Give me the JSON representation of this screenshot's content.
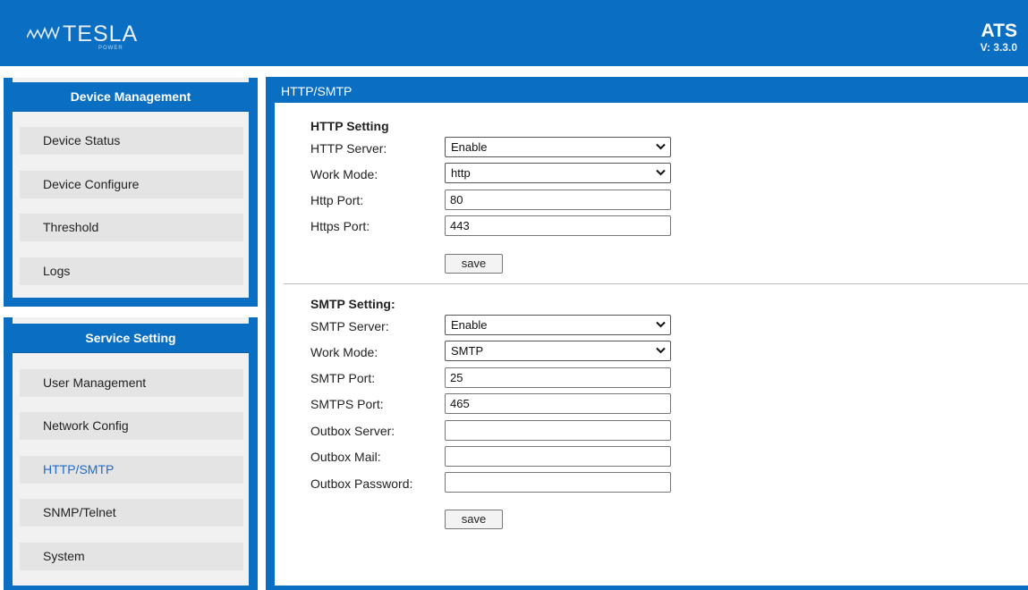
{
  "header": {
    "logo_text": "TESLA",
    "logo_sub": "POWER",
    "product": "ATS",
    "version": "V: 3.3.0"
  },
  "colors": {
    "brand_blue": "#0a6fc2",
    "active_link": "#1e6bc7",
    "panel_bg": "#f1f1f1",
    "nav_item_bg": "#e4e4e4"
  },
  "device_management": {
    "title": "Device Management",
    "items": [
      {
        "label": "Device Status"
      },
      {
        "label": "Device Configure"
      },
      {
        "label": "Threshold"
      },
      {
        "label": "Logs"
      }
    ]
  },
  "service_setting": {
    "title": "Service Setting",
    "items": [
      {
        "label": "User Management"
      },
      {
        "label": "Network Config"
      },
      {
        "label": "HTTP/SMTP",
        "active": true
      },
      {
        "label": "SNMP/Telnet"
      },
      {
        "label": "System"
      }
    ]
  },
  "main": {
    "title": "HTTP/SMTP",
    "http": {
      "section_title": "HTTP Setting",
      "server_label": "HTTP Server:",
      "server_value": "Enable",
      "mode_label": "Work Mode:",
      "mode_value": "http",
      "port_label": "Http Port:",
      "port_value": "80",
      "https_port_label": "Https Port:",
      "https_port_value": "443",
      "save_label": "save"
    },
    "smtp": {
      "section_title": "SMTP Setting:",
      "server_label": "SMTP Server:",
      "server_value": "Enable",
      "mode_label": "Work Mode:",
      "mode_value": "SMTP",
      "port_label": "SMTP Port:",
      "port_value": "25",
      "smtps_port_label": "SMTPS Port:",
      "smtps_port_value": "465",
      "outbox_server_label": "Outbox Server:",
      "outbox_server_value": "",
      "outbox_mail_label": "Outbox Mail:",
      "outbox_mail_value": "",
      "outbox_password_label": "Outbox Password:",
      "outbox_password_value": "",
      "save_label": "save"
    }
  }
}
